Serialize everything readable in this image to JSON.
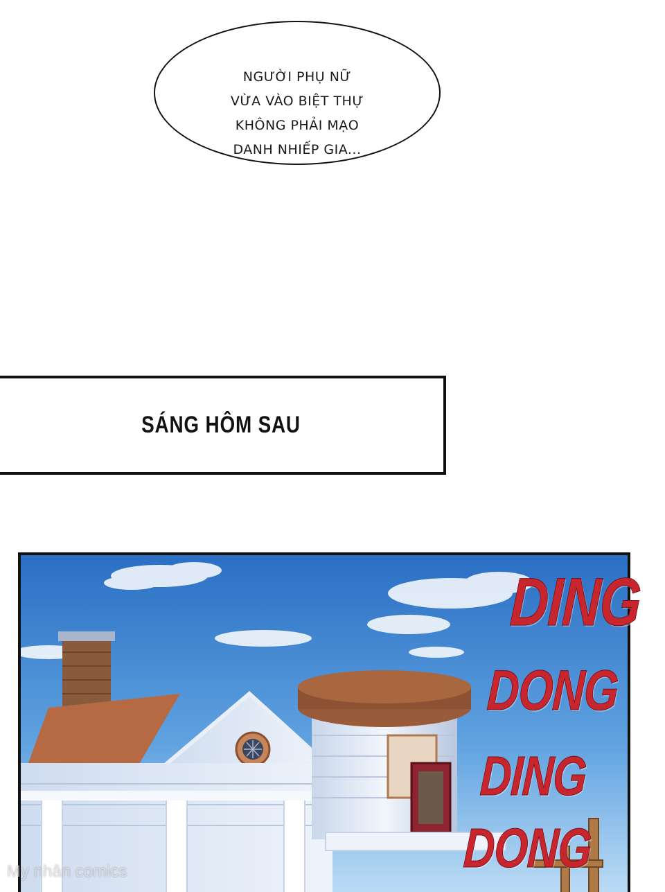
{
  "speech_bubble": {
    "lines": [
      "NGƯỜI PHỤ NỮ",
      "VỪA VÀO BIỆT THỰ",
      "KHÔNG PHẢI MẠO",
      "DANH NHIẾP GIA..."
    ]
  },
  "caption": {
    "text": "SÁNG HÔM SAU"
  },
  "sound_effects": [
    "DING",
    "DONG",
    "DING",
    "DONG"
  ],
  "watermark": "My nhân comics",
  "colors": {
    "sky": "#2f78c6",
    "sfx_red": "#c8262f",
    "ink": "#111111"
  }
}
